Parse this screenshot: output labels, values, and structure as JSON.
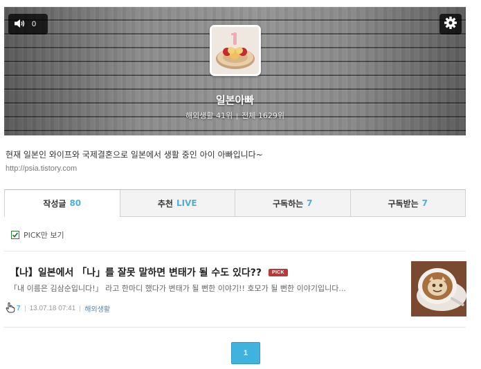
{
  "header": {
    "sound_count": "0",
    "blog_title": "일본아빠",
    "category_rank": "해외생활 41위",
    "overall_rank": "전체 1629위"
  },
  "profile": {
    "description": "현재 일본인 와이프와 국제결혼으로 일본에서 생활 중인 아이 아빠입니다~",
    "url": "http://psia.tistory.com"
  },
  "tabs": [
    {
      "label": "작성글",
      "count": "80"
    },
    {
      "label": "추천",
      "count": "LIVE"
    },
    {
      "label": "구독하는",
      "count": "7"
    },
    {
      "label": "구독받는",
      "count": "7"
    }
  ],
  "filter": {
    "pick_only_label": "PICK만 보기"
  },
  "post": {
    "title": "【나】일본에서 「나」를 잘못 말하면 변태가 될 수도 있다??",
    "badge": "PICK",
    "excerpt": "「내 이름은 김삼순입니다!」 라고 한마디 했다가 변태가 될 뻔한 이야기!! 호모가 될 뻔한 이야기입니다...",
    "likes": "7",
    "date": "13.07.18 07:41",
    "category": "해외생활"
  },
  "pagination": {
    "current": "1"
  },
  "colors": {
    "accent": "#4ab0d8",
    "pick_badge": "#b73a3a",
    "page_button": "#3fb3dd"
  }
}
